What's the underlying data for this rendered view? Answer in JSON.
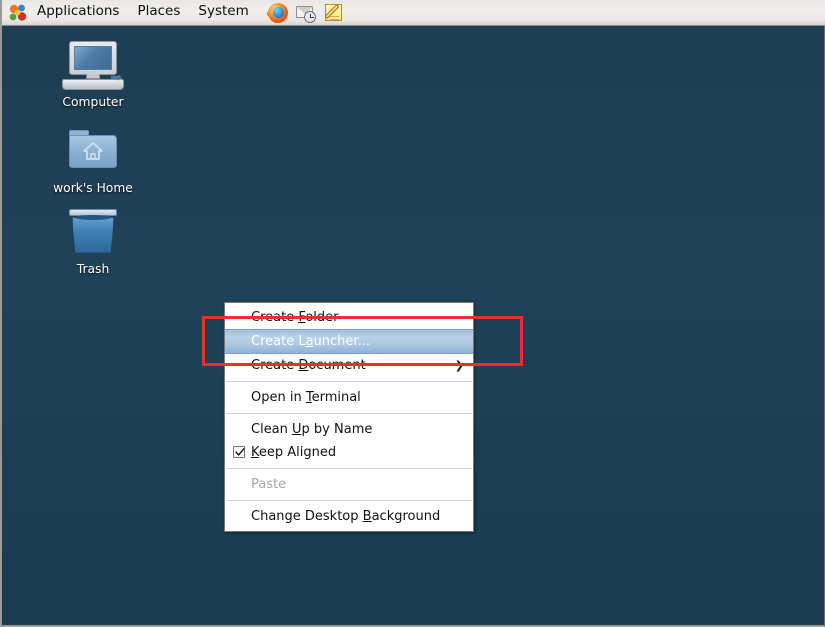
{
  "desktop": {
    "background_color_top": "#1d3d52",
    "background_color_bottom": "#1a3b50",
    "icons": [
      {
        "id": "computer",
        "label": "Computer",
        "icon": "computer-icon"
      },
      {
        "id": "home",
        "label": "work's Home",
        "icon": "home-folder-icon"
      },
      {
        "id": "trash",
        "label": "Trash",
        "icon": "trash-icon"
      }
    ]
  },
  "panel": {
    "logo": "gnome-foot-icon",
    "menus": [
      {
        "id": "applications",
        "label": "Applications"
      },
      {
        "id": "places",
        "label": "Places"
      },
      {
        "id": "system",
        "label": "System"
      }
    ],
    "launchers": [
      {
        "id": "firefox",
        "name": "firefox-icon",
        "title": "Firefox Web Browser"
      },
      {
        "id": "evolution",
        "name": "evolution-mail-icon",
        "title": "Evolution Mail"
      },
      {
        "id": "gedit",
        "name": "text-editor-icon",
        "title": "Text Editor"
      }
    ]
  },
  "context_menu": {
    "items": [
      {
        "type": "item",
        "id": "create-folder",
        "label": "Create Folder",
        "mnemonic": "F",
        "pre": "Create ",
        "post": "older",
        "selected": false,
        "disabled": false,
        "submenu": false,
        "checkbox": false
      },
      {
        "type": "item",
        "id": "create-launcher",
        "label": "Create Launcher...",
        "mnemonic": "a",
        "pre": "Create L",
        "post": "uncher...",
        "selected": true,
        "disabled": false,
        "submenu": false,
        "checkbox": false
      },
      {
        "type": "item",
        "id": "create-document",
        "label": "Create Document",
        "mnemonic": "D",
        "pre": "Create ",
        "post": "ocument",
        "selected": false,
        "disabled": false,
        "submenu": true,
        "checkbox": false
      },
      {
        "type": "separator",
        "id": "separator-1"
      },
      {
        "type": "item",
        "id": "open-in-terminal",
        "label": "Open in Terminal",
        "mnemonic": "T",
        "pre": "Open in ",
        "post": "erminal",
        "selected": false,
        "disabled": false,
        "submenu": false,
        "checkbox": false
      },
      {
        "type": "separator",
        "id": "separator-2"
      },
      {
        "type": "item",
        "id": "clean-up-by-name",
        "label": "Clean Up by Name",
        "mnemonic": "U",
        "pre": "Clean ",
        "post": "p by Name",
        "selected": false,
        "disabled": false,
        "submenu": false,
        "checkbox": false
      },
      {
        "type": "item",
        "id": "keep-aligned",
        "label": "Keep Aligned",
        "mnemonic": "K",
        "pre": "",
        "post": "eep Aligned",
        "selected": false,
        "disabled": false,
        "submenu": false,
        "checkbox": true,
        "checked": true
      },
      {
        "type": "separator",
        "id": "separator-3"
      },
      {
        "type": "item",
        "id": "paste",
        "label": "Paste",
        "mnemonic": "",
        "pre": "Paste",
        "post": "",
        "selected": false,
        "disabled": true,
        "submenu": false,
        "checkbox": false
      },
      {
        "type": "separator",
        "id": "separator-4"
      },
      {
        "type": "item",
        "id": "change-desktop-background",
        "label": "Change Desktop Background",
        "mnemonic": "B",
        "pre": "Change Desktop ",
        "post": "ackground",
        "selected": false,
        "disabled": false,
        "submenu": false,
        "checkbox": false
      }
    ],
    "submenu_arrow_glyph": "❯",
    "highlight_color": "#a9c6e2"
  },
  "annotation": {
    "id": "red-highlight-box",
    "color": "#e8302d",
    "targets": "create-launcher"
  }
}
